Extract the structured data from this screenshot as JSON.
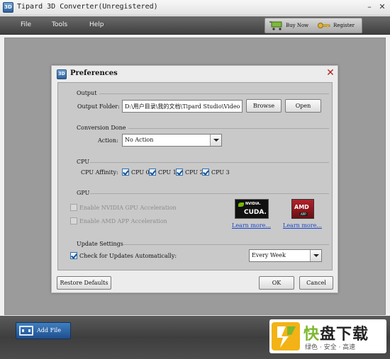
{
  "app": {
    "title": "Tipard 3D Converter(Unregistered)",
    "icon_text": "3D",
    "minimize": "–",
    "close": "✕"
  },
  "menu": {
    "items": [
      "File",
      "Tools",
      "Help"
    ],
    "buy_now": "Buy Now",
    "register": "Register"
  },
  "dialog": {
    "title": "Preferences",
    "icon_text": "3D",
    "close_glyph": "✕",
    "output": {
      "section": "Output",
      "folder_label": "Output Folder:",
      "folder_value": "D:\\用户目录\\我的文档\\Tipard Studio\\Video",
      "browse": "Browse",
      "open": "Open"
    },
    "conversion": {
      "section": "Conversion Done",
      "action_label": "Action:",
      "action_value": "No Action"
    },
    "cpu": {
      "section": "CPU",
      "affinity_label": "CPU Affinity:",
      "cores": [
        {
          "label": "CPU 0",
          "checked": true
        },
        {
          "label": "CPU 1",
          "checked": true
        },
        {
          "label": "CPU 2",
          "checked": true
        },
        {
          "label": "CPU 3",
          "checked": true
        }
      ]
    },
    "gpu": {
      "section": "GPU",
      "nvidia_option": "Enable NVIDIA GPU Acceleration",
      "amd_option": "Enable AMD APP Acceleration",
      "nvidia_logo_top": "NVIDIA.",
      "nvidia_logo_main": "CUDA.",
      "amd_logo_main": "AMD",
      "amd_logo_sub": "APP",
      "learn_more_nvidia": "Learn more...",
      "learn_more_amd": "Learn more..."
    },
    "update": {
      "section": "Update Settings",
      "check_label": "Check for Updates Automatically:",
      "checked": true,
      "frequency": "Every Week"
    },
    "restore_defaults": "Restore Defaults",
    "ok": "OK",
    "cancel": "Cancel"
  },
  "footer": {
    "add_file": "Add File"
  },
  "watermark": {
    "brand_green": "快",
    "brand_rest": "盘下载",
    "tagline": "绿色 · 安全 · 高速"
  },
  "colors": {
    "menubar": "#4f4f4f",
    "workspace": "#9b9b9b",
    "panel": "#c9c9c9",
    "checkbox": "#2d6fb4",
    "link": "#1a46c8",
    "close": "#b02020",
    "watermark_green": "#7cb82f"
  },
  "icons": {
    "cart": "shopping-cart-icon",
    "key": "key-icon",
    "film": "film-icon"
  }
}
